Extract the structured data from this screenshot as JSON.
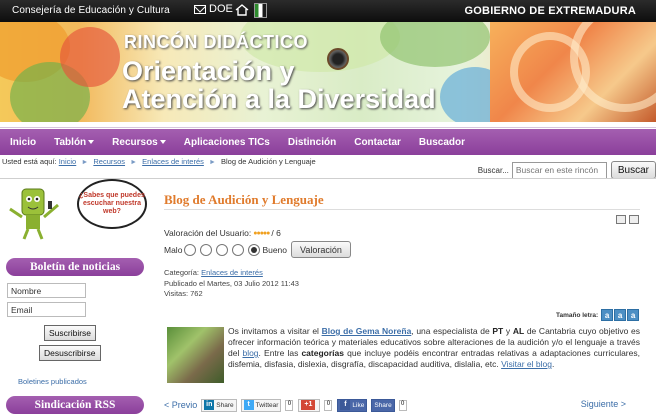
{
  "topbar": {
    "consejeria": "Consejería de Educación y Cultura",
    "doe": "DOE",
    "gobierno": "GOBIERNO DE EXTREMADURA"
  },
  "banner": {
    "kicker": "RINCÓN DIDÁCTICO",
    "line1": "Orientación y",
    "line2": "Atención a la Diversidad"
  },
  "nav": {
    "items": [
      {
        "label": "Inicio"
      },
      {
        "label": "Tablón"
      },
      {
        "label": "Recursos"
      },
      {
        "label": "Aplicaciones TICs"
      },
      {
        "label": "Distinción"
      },
      {
        "label": "Contactar"
      },
      {
        "label": "Buscador"
      }
    ]
  },
  "breadcrumb": {
    "prefix": "Usted está aquí:",
    "crumbs": [
      "Inicio",
      "Recursos",
      "Enlaces de interés"
    ],
    "current": "Blog de Audición y Lenguaje"
  },
  "search": {
    "label": "Buscar...",
    "placeholder": "Buscar en este rincón",
    "button": "Buscar"
  },
  "sidebar": {
    "bubble": "¿Sabes que puedes escuchar nuestra web?",
    "newsletter_title": "Boletín de noticias",
    "name_value": "Nombre",
    "email_value": "Email",
    "subscribe": "Suscribirse",
    "unsubscribe": "Desuscribirse",
    "published_link": "Boletines publicados",
    "syndication_title": "Sindicación RSS"
  },
  "article": {
    "title": "Blog de Audición y Lenguaje",
    "rating_label": "Valoración del Usuario:",
    "rating_stars": "●●●●●",
    "rating_value": "/ 6",
    "bad": "Malo",
    "good": "Bueno",
    "vote_button": "Valoración",
    "category_label": "Categoría:",
    "category_link": "Enlaces de interés",
    "published": "Publicado el Martes, 03 Julio 2012 11:43",
    "visits": "Visitas: 762",
    "font_size_label": "Tamaño letra:",
    "body_1": "Os invitamos a visitar el ",
    "body_link1": "Blog de Gema Noreña",
    "body_2": ", una especialista de ",
    "body_pt": "PT",
    "body_3": " y ",
    "body_al": "AL",
    "body_4": " de Cantabria cuyo objetivo es ofrecer información teórica y materiales educativos sobre alteraciones de la audición y/o el lenguaje a través del ",
    "body_link2": "blog",
    "body_5": ". Entre las ",
    "body_cat": "categorías",
    "body_6": " que incluye podéis encontrar entradas relativas a adaptaciones curriculares, disfemia, disfasia, dislexia, disgrafía, discapacidad auditiva, dislalia, etc. ",
    "body_link3": "Visitar el blog",
    "body_7": ".",
    "prev": "< Previo",
    "next": "Siguiente >",
    "share_linkedin": "Share",
    "share_twitter": "Twittear",
    "share_gplus": "+1",
    "share_fb_like": "Like",
    "share_fb_share": "Share",
    "count_0": "0",
    "count_gplus": "0"
  },
  "colors": {
    "accent": "#9a4fa8",
    "title": "#e07b2c",
    "link": "#3c6ea8"
  }
}
